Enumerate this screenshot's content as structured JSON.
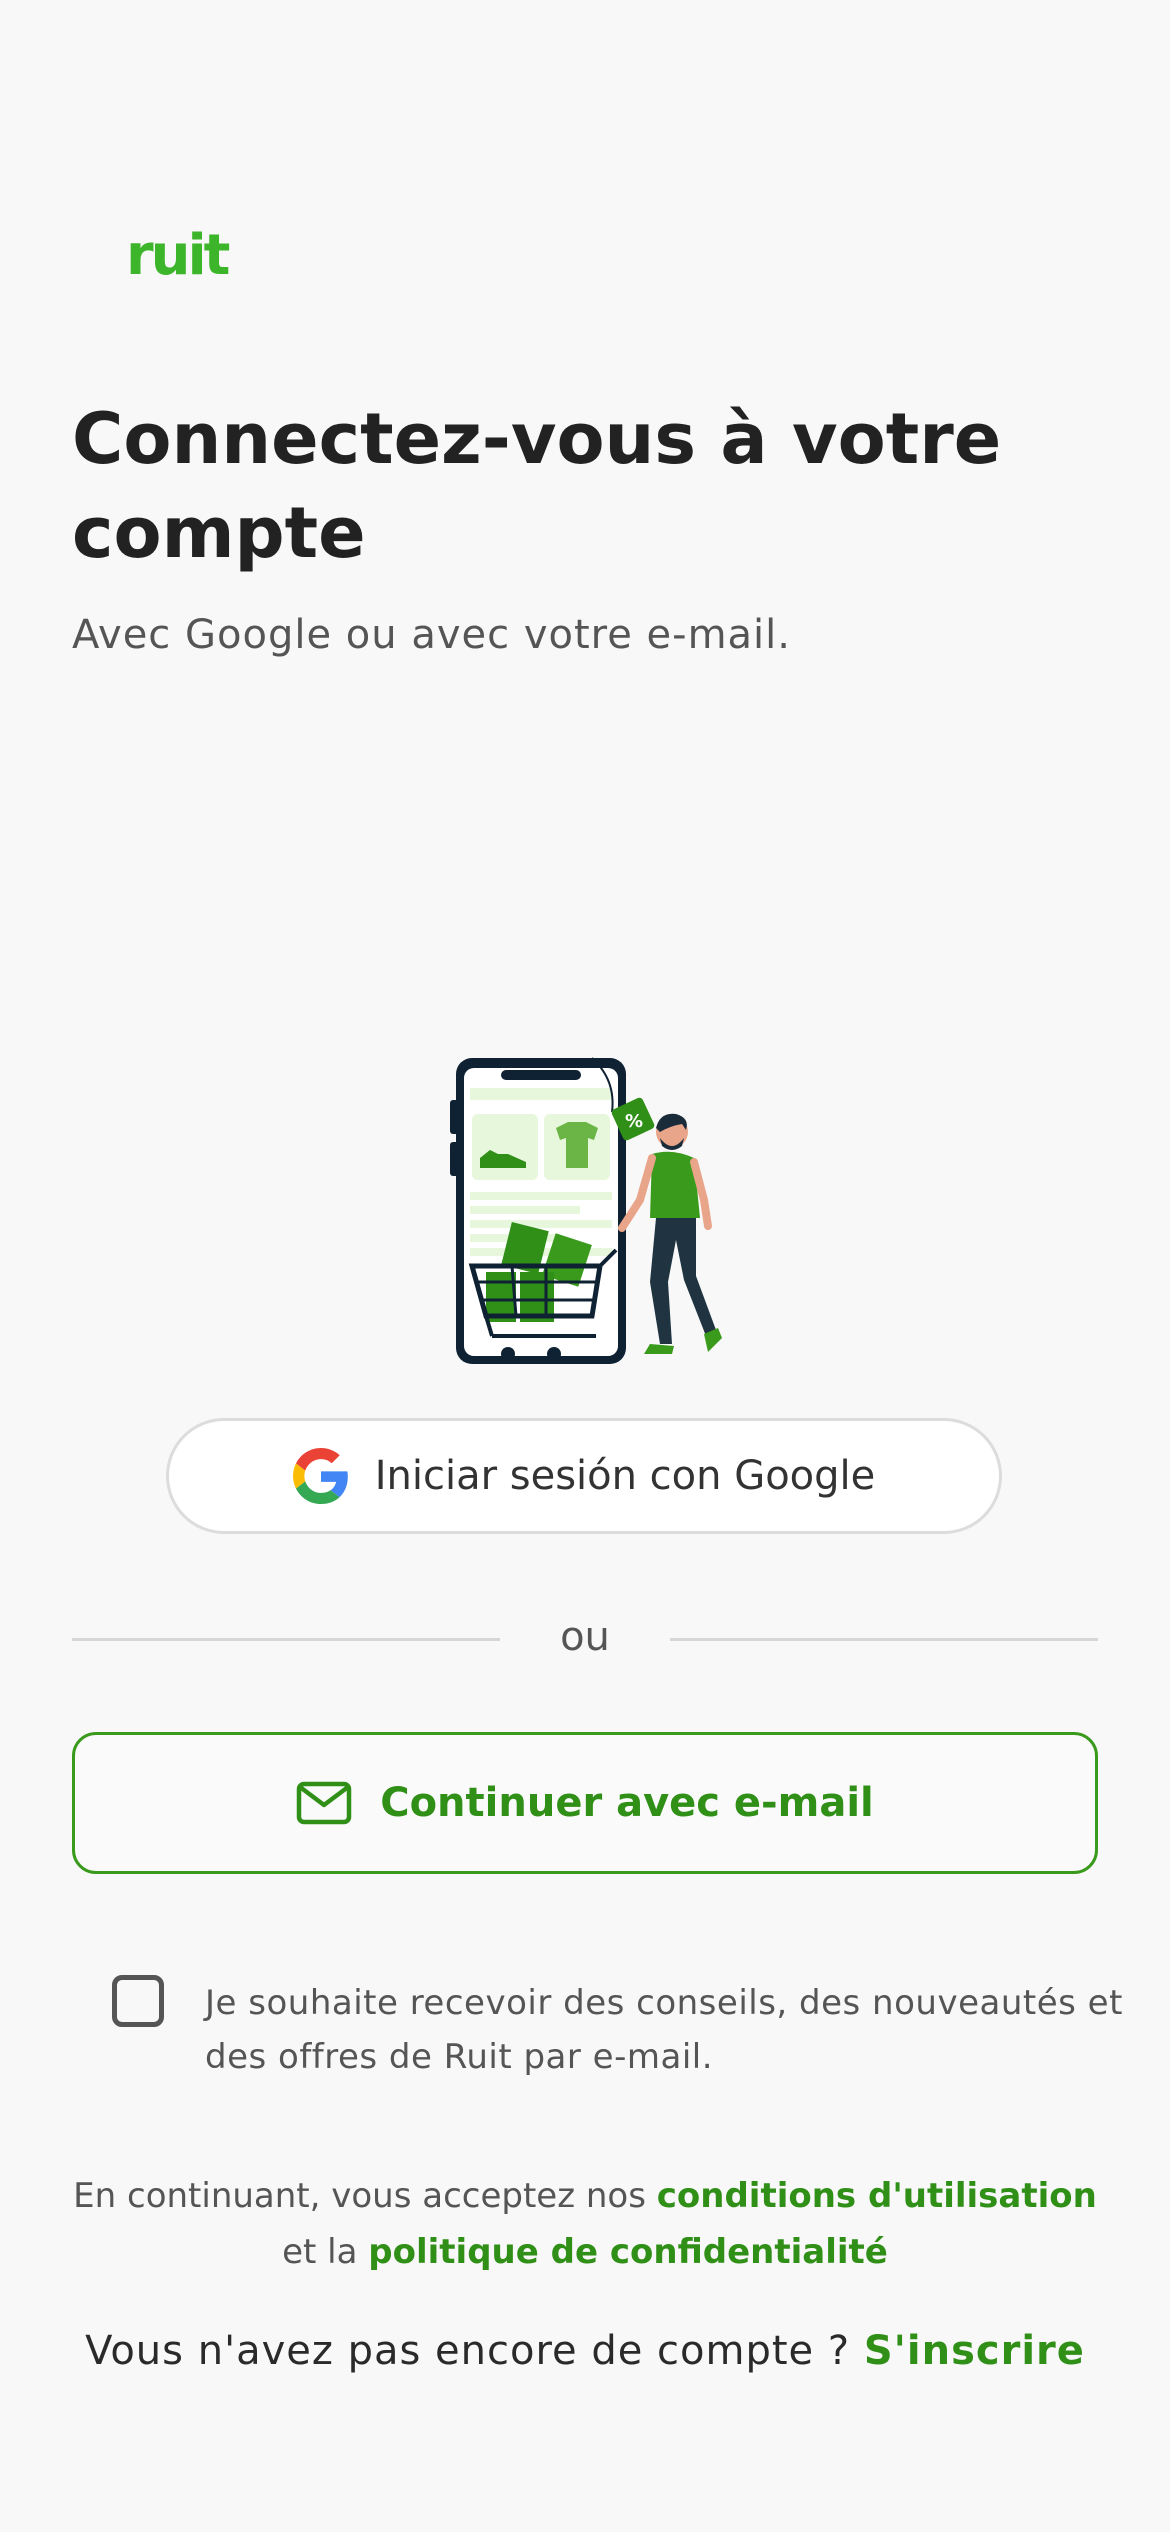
{
  "brand": {
    "logo_text": "ruit",
    "accent_color": "#2f8f17",
    "logo_color": "#3cb52a"
  },
  "header": {
    "title": "Connectez-vous à votre compte",
    "subtitle": "Avec Google ou avec votre e-mail."
  },
  "illustration": {
    "icon": "shopping-phone-illustration",
    "tag_text": "%"
  },
  "google_button": {
    "icon": "google-g-icon",
    "label": "Iniciar sesión con Google"
  },
  "divider": {
    "text": "ou"
  },
  "email_button": {
    "icon": "envelope-icon",
    "label": "Continuer avec e-mail"
  },
  "newsletter": {
    "checked": false,
    "text": "Je souhaite recevoir des conseils, des nouveautés et des offres de Ruit par e-mail."
  },
  "legal": {
    "prefix": "En continuant, vous acceptez nos",
    "terms_link": "conditions d'utilisation",
    "middle": "et la",
    "privacy_link": "politique de confidentialité"
  },
  "signup": {
    "prompt": "Vous n'avez pas encore de compte ?",
    "link": "S'inscrire"
  }
}
